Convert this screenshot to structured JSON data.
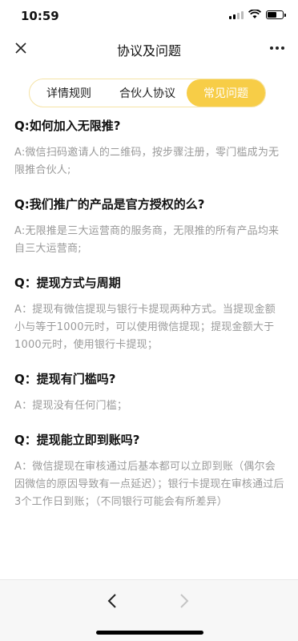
{
  "status": {
    "time": "10:59"
  },
  "nav": {
    "title": "协议及问题"
  },
  "tabs": [
    {
      "label": "详情规则",
      "active": false
    },
    {
      "label": "合伙人协议",
      "active": false
    },
    {
      "label": "常见问题",
      "active": true
    }
  ],
  "faq": [
    {
      "q": "Q:如何加入无限推?",
      "a": "A:微信扫码邀请人的二维码，按步骤注册，零门槛成为无限推合伙人;"
    },
    {
      "q": "Q:我们推广的产品是官方授权的么?",
      "a": "A:无限推是三大运营商的服务商，无限推的所有产品均来自三大运营商;"
    },
    {
      "q": "Q：提现方式与周期",
      "a": "A：提现有微信提现与银行卡提现两种方式。当提现金额小与等于1000元时，可以使用微信提现；提现金额大于1000元时，使用银行卡提现；"
    },
    {
      "q": "Q：提现有门槛吗?",
      "a": "A：提现没有任何门槛；"
    },
    {
      "q": "Q：提现能立即到账吗?",
      "a": "A：微信提现在审核通过后基本都可以立即到账（偶尔会因微信的原因导致有一点延迟）；银行卡提现在审核通过后3个工作日到账；（不同银行可能会有所差异）"
    }
  ],
  "colors": {
    "accent": "#f7cd47",
    "answer": "#9a9a9a"
  }
}
